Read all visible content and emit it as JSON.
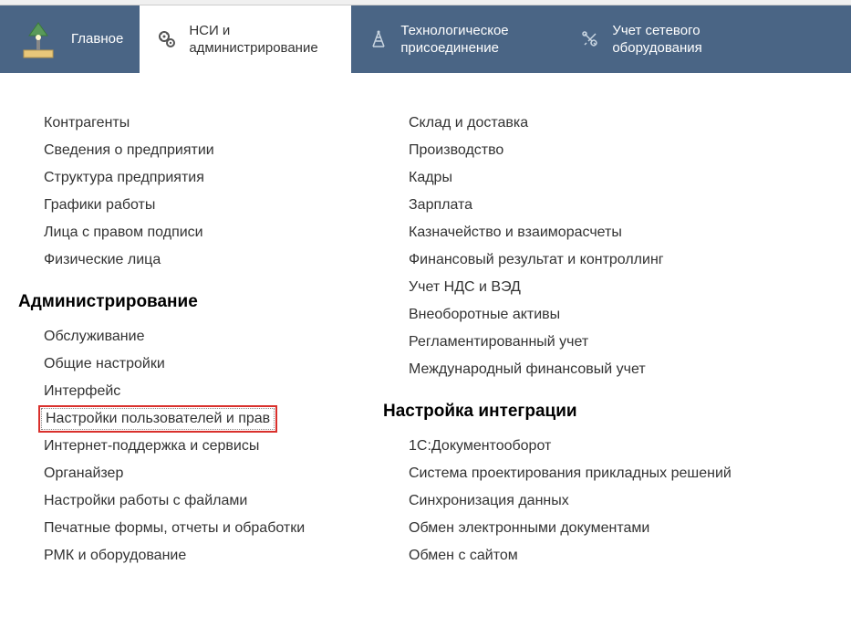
{
  "nav": {
    "items": [
      {
        "label": "Главное"
      },
      {
        "label": "НСИ и администрирование"
      },
      {
        "label": "Технологическое присоединение"
      },
      {
        "label": "Учет сетевого оборудования"
      }
    ]
  },
  "left_column": {
    "top_links": [
      "Контрагенты",
      "Сведения о предприятии",
      "Структура предприятия",
      "Графики работы",
      "Лица с правом подписи",
      "Физические лица"
    ],
    "admin_title": "Администрирование",
    "admin_links": [
      "Обслуживание",
      "Общие настройки",
      "Интерфейс",
      "Настройки пользователей и прав",
      "Интернет-поддержка и сервисы",
      "Органайзер",
      "Настройки работы с файлами",
      "Печатные формы, отчеты и обработки",
      "РМК и оборудование"
    ]
  },
  "right_column": {
    "top_links": [
      "Склад и доставка",
      "Производство",
      "Кадры",
      "Зарплата",
      "Казначейство и взаиморасчеты",
      "Финансовый результат и контроллинг",
      "Учет НДС и ВЭД",
      "Внеоборотные активы",
      "Регламентированный учет",
      "Международный финансовый учет"
    ],
    "integration_title": "Настройка интеграции",
    "integration_links": [
      "1С:Документооборот",
      "Система проектирования прикладных решений",
      "Синхронизация данных",
      "Обмен электронными документами",
      "Обмен с сайтом"
    ]
  }
}
